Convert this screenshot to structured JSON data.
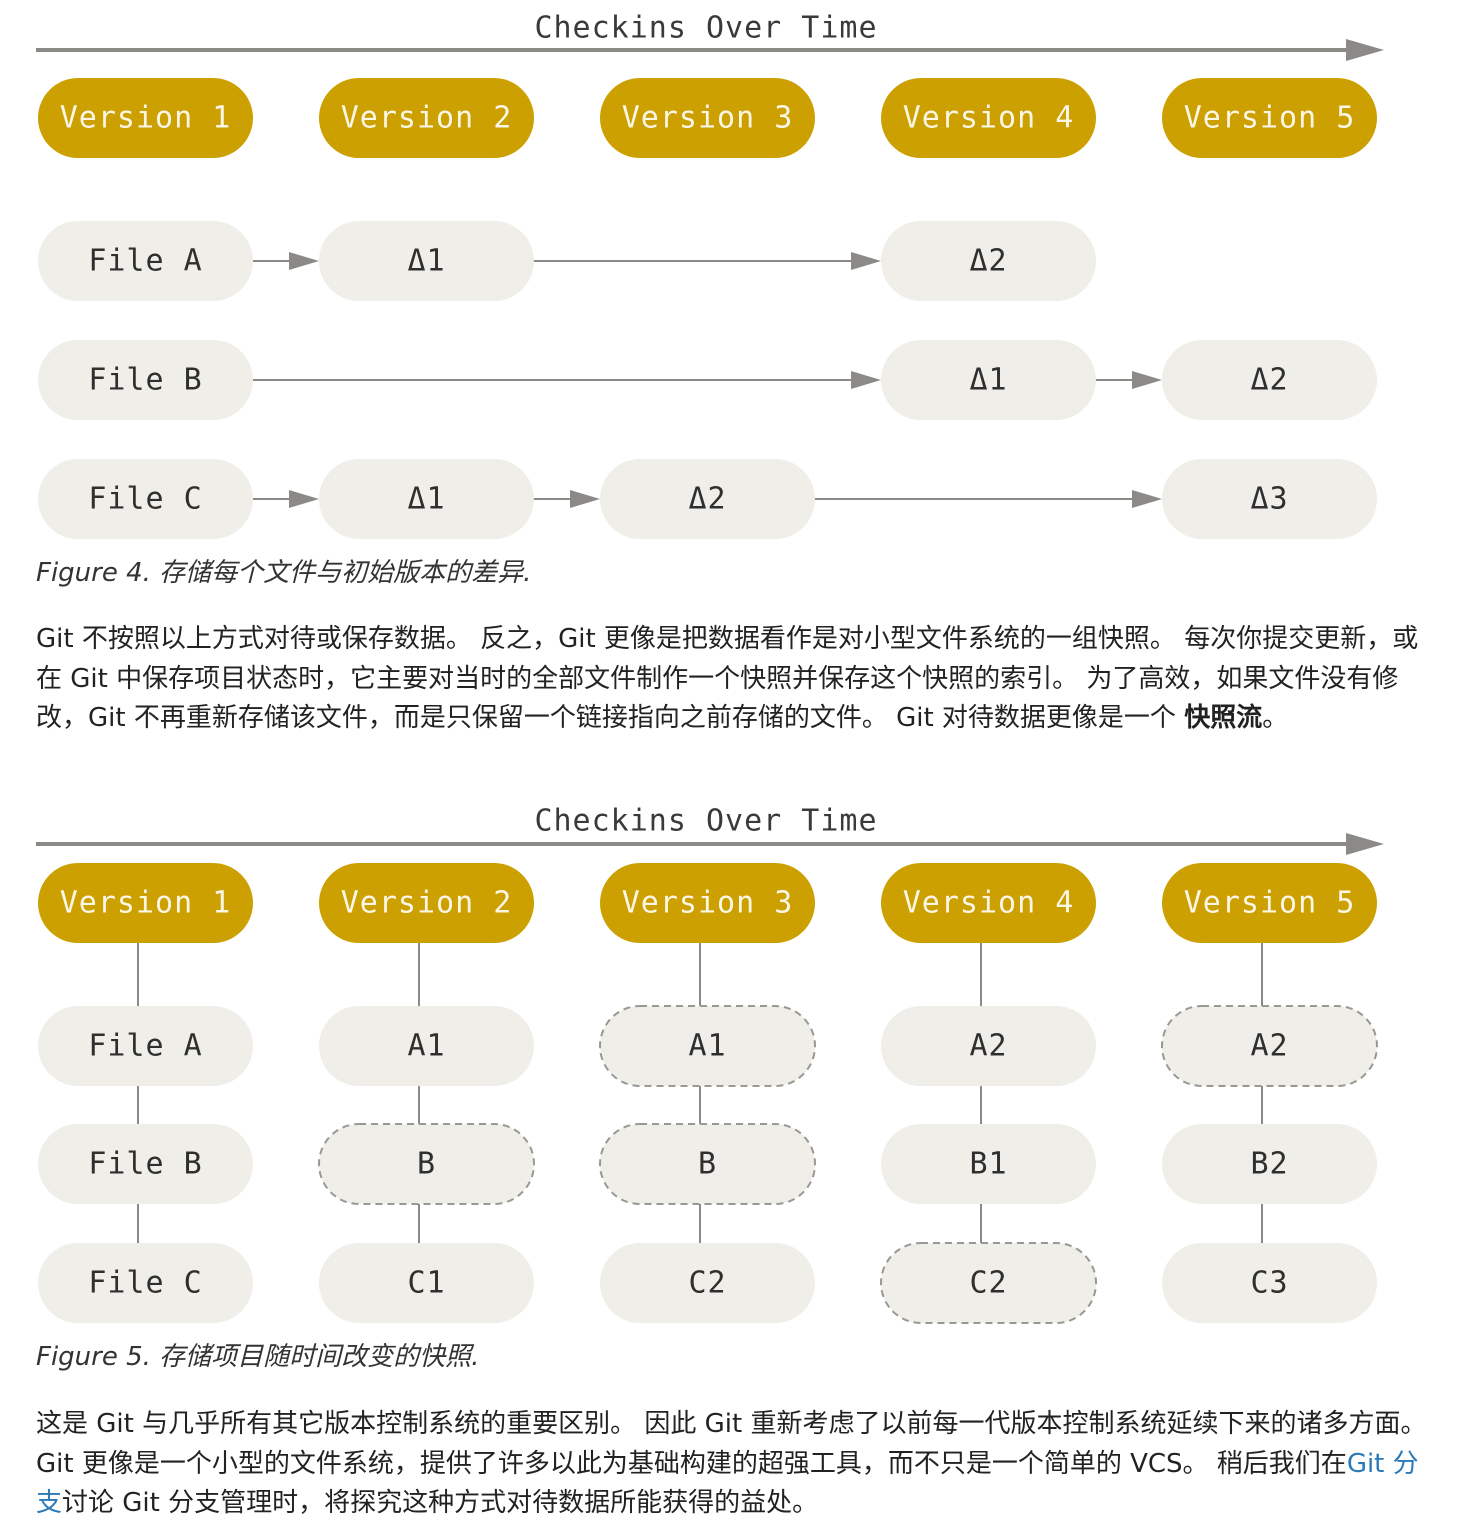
{
  "figure4": {
    "title": "Checkins Over Time",
    "versions": [
      "Version 1",
      "Version 2",
      "Version 3",
      "Version 4",
      "Version 5"
    ],
    "rows": [
      {
        "file": "File A",
        "cells": [
          "Δ1",
          "",
          "Δ2",
          ""
        ]
      },
      {
        "file": "File B",
        "cells": [
          "",
          "",
          "Δ1",
          "Δ2"
        ]
      },
      {
        "file": "File C",
        "cells": [
          "Δ1",
          "Δ2",
          "",
          "Δ3"
        ]
      }
    ],
    "caption": "Figure 4. 存储每个文件与初始版本的差异."
  },
  "paragraph1": {
    "text": "Git 不按照以上方式对待或保存数据。 反之，Git 更像是把数据看作是对小型文件系统的一组快照。 每次你提交更新，或在 Git 中保存项目状态时，它主要对当时的全部文件制作一个快照并保存这个快照的索引。 为了高效，如果文件没有修改，Git 不再重新存储该文件，而是只保留一个链接指向之前存储的文件。 Git 对待数据更像是一个 ",
    "bold": "快照流",
    "end": "。"
  },
  "figure5": {
    "title": "Checkins Over Time",
    "versions": [
      "Version 1",
      "Version 2",
      "Version 3",
      "Version 4",
      "Version 5"
    ],
    "rows": [
      {
        "file": "File A",
        "cells": [
          {
            "label": "A1",
            "dashed": false
          },
          {
            "label": "A1",
            "dashed": true
          },
          {
            "label": "A2",
            "dashed": false
          },
          {
            "label": "A2",
            "dashed": true
          }
        ]
      },
      {
        "file": "File B",
        "cells": [
          {
            "label": "B",
            "dashed": true
          },
          {
            "label": "B",
            "dashed": true
          },
          {
            "label": "B1",
            "dashed": false
          },
          {
            "label": "B2",
            "dashed": false
          }
        ]
      },
      {
        "file": "File C",
        "cells": [
          {
            "label": "C1",
            "dashed": false
          },
          {
            "label": "C2",
            "dashed": false
          },
          {
            "label": "C2",
            "dashed": true
          },
          {
            "label": "C3",
            "dashed": false
          }
        ]
      }
    ],
    "caption": "Figure 5. 存储项目随时间改变的快照."
  },
  "paragraph2": {
    "text_before": "这是 Git 与几乎所有其它版本控制系统的重要区别。 因此 Git 重新考虑了以前每一代版本控制系统延续下来的诸多方面。 Git 更像是一个小型的文件系统，提供了许多以此为基础构建的超强工具，而不只是一个简单的 VCS。 稍后我们在",
    "link": "Git 分支",
    "text_after": "讨论 Git 分支管理时，将探究这种方式对待数据所能获得的益处。"
  },
  "colors": {
    "version_fill": "#cba000",
    "version_text": "#fbf6e6",
    "file_fill": "#efeee9",
    "line": "#8c8a86",
    "dashed": "#9a9893"
  }
}
